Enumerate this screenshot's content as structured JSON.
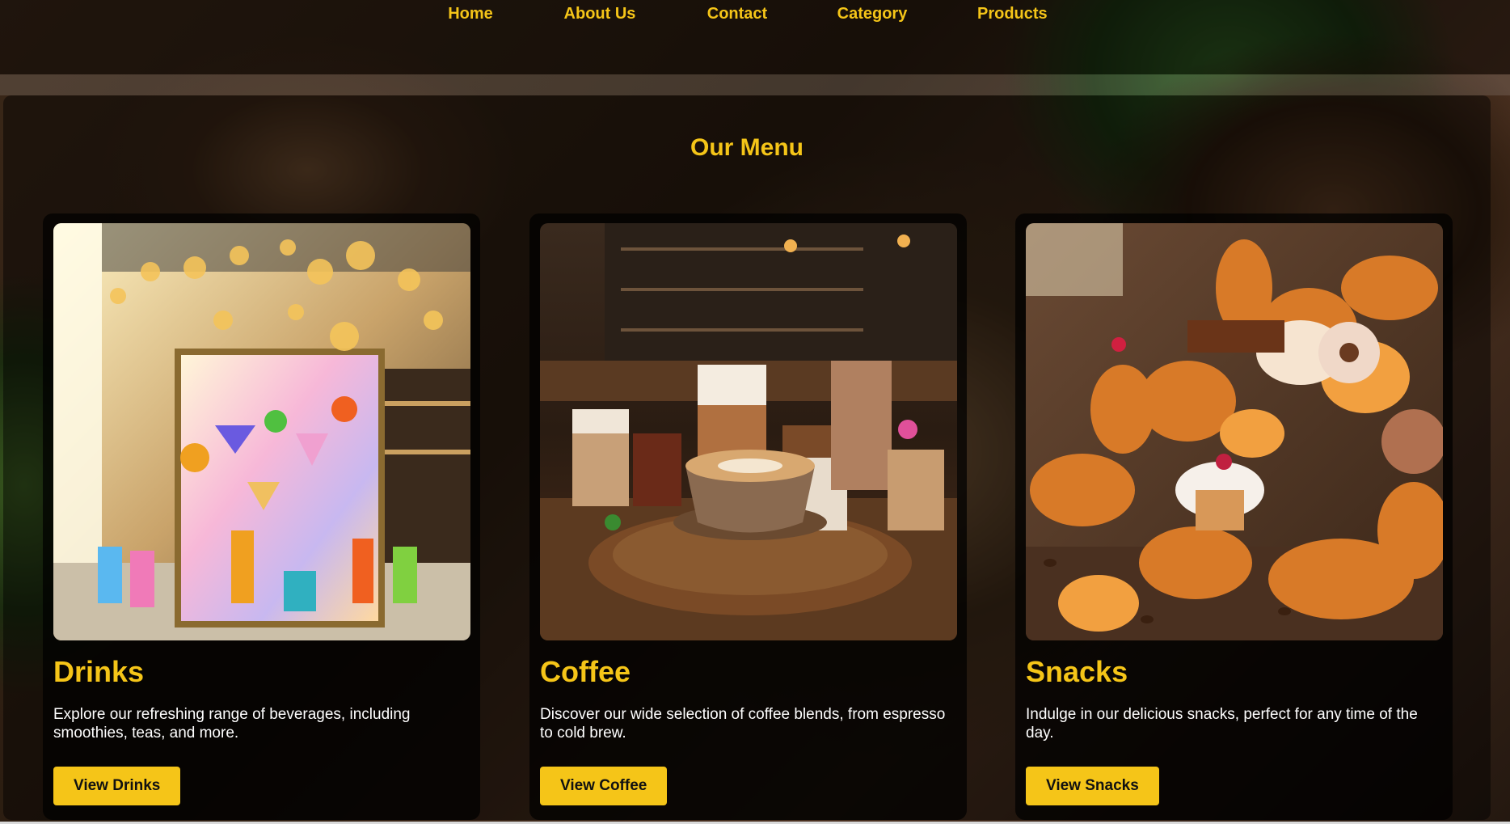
{
  "nav": {
    "items": [
      {
        "label": "Home"
      },
      {
        "label": "About Us"
      },
      {
        "label": "Contact"
      },
      {
        "label": "Category"
      },
      {
        "label": "Products"
      }
    ]
  },
  "menu": {
    "title": "Our Menu",
    "cards": [
      {
        "title": "Drinks",
        "description": "Explore our refreshing range of beverages, including smoothies, teas, and more.",
        "button_label": "View Drinks",
        "image_alt": "Drinks"
      },
      {
        "title": "Coffee",
        "description": "Discover our wide selection of coffee blends, from espresso to cold brew.",
        "button_label": "View Coffee",
        "image_alt": "Coffee"
      },
      {
        "title": "Snacks",
        "description": "Indulge in our delicious snacks, perfect for any time of the day.",
        "button_label": "View Snacks",
        "image_alt": "Snacks"
      }
    ]
  },
  "colors": {
    "accent": "#f5c518",
    "card_background": "#000000",
    "text": "#ffffff"
  }
}
